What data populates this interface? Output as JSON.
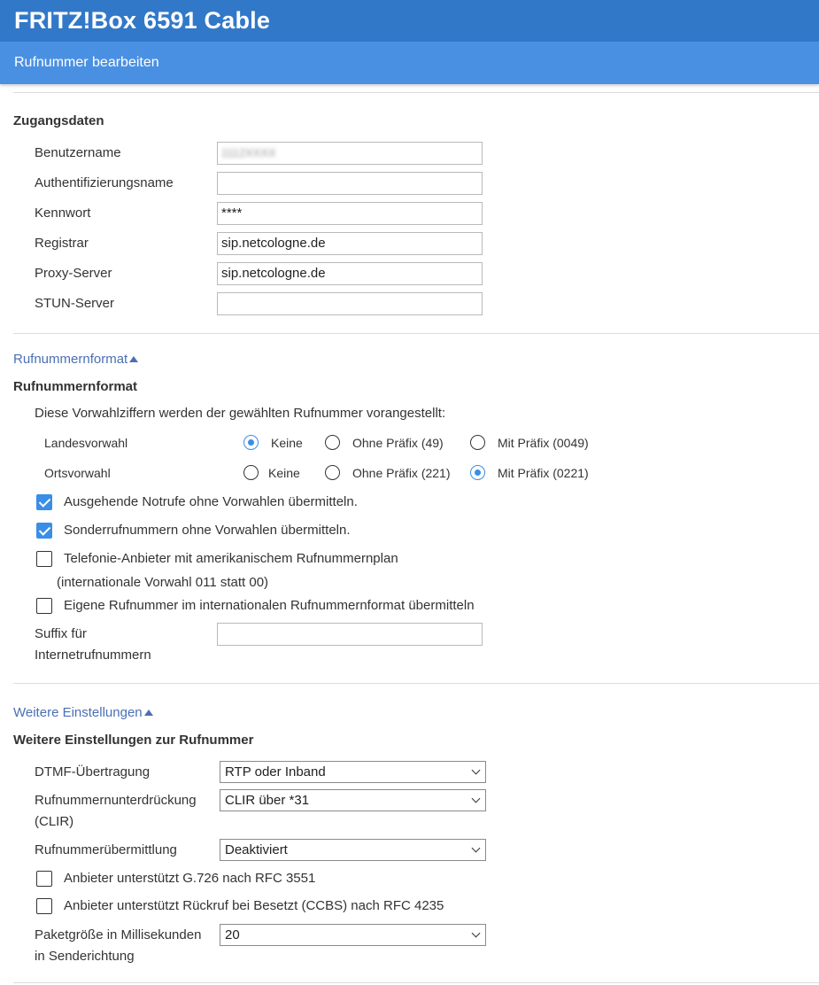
{
  "header": {
    "title": "FRITZ!Box 6591 Cable",
    "subtitle": "Rufnummer bearbeiten"
  },
  "zugang": {
    "title": "Zugangsdaten",
    "fields": [
      {
        "label": "Benutzername",
        "value": "1112XXXX"
      },
      {
        "label": "Authentifizierungsname",
        "value": ""
      },
      {
        "label": "Kennwort",
        "value": "****"
      },
      {
        "label": "Registrar",
        "value": "sip.netcologne.de"
      },
      {
        "label": "Proxy-Server",
        "value": "sip.netcologne.de"
      },
      {
        "label": "STUN-Server",
        "value": ""
      }
    ]
  },
  "format": {
    "toggle": "Rufnummernformat",
    "title": "Rufnummernformat",
    "intro": "Diese Vorwahlziffern werden der gewählten Rufnummer vorangestellt:",
    "landes": {
      "label": "Landesvorwahl",
      "options": [
        "Keine",
        "Ohne Präfix (49)",
        "Mit Präfix (0049)"
      ],
      "selected": "Keine"
    },
    "orts": {
      "label": "Ortsvorwahl",
      "options": [
        "Keine",
        "Ohne Präfix (221)",
        "Mit Präfix (0221)"
      ],
      "selected": "Mit Präfix (0221)"
    },
    "checks": [
      {
        "label": "Ausgehende Notrufe ohne Vorwahlen übermitteln.",
        "checked": true
      },
      {
        "label": "Sonderrufnummern ohne Vorwahlen übermitteln.",
        "checked": true
      },
      {
        "label": "Telefonie-Anbieter mit amerikanischem Rufnummernplan",
        "checked": false
      },
      {
        "label": "Eigene Rufnummer im internationalen Rufnummernformat übermitteln",
        "checked": false
      }
    ],
    "usa_note": "(internationale Vorwahl 011 statt 00)",
    "suffix_label_1": "Suffix für",
    "suffix_label_2": "Internetrufnummern",
    "suffix_value": ""
  },
  "weitere": {
    "toggle": "Weitere Einstellungen",
    "title": "Weitere Einstellungen zur Rufnummer",
    "dtmf": {
      "label": "DTMF-Übertragung",
      "value": "RTP oder Inband"
    },
    "clir": {
      "label_1": "Rufnummernunterdrückung",
      "label_2": "(CLIR)",
      "value": "CLIR über *31"
    },
    "clip": {
      "label": "Rufnummerübermittlung",
      "value": "Deaktiviert"
    },
    "checks": [
      {
        "label": "Anbieter unterstützt G.726 nach RFC 3551",
        "checked": false
      },
      {
        "label": "Anbieter unterstützt Rückruf bei Besetzt (CCBS) nach RFC 4235",
        "checked": false
      }
    ],
    "paket": {
      "label_1": "Paketgröße in Millisekunden",
      "label_2": "in Senderichtung",
      "value": "20"
    }
  }
}
